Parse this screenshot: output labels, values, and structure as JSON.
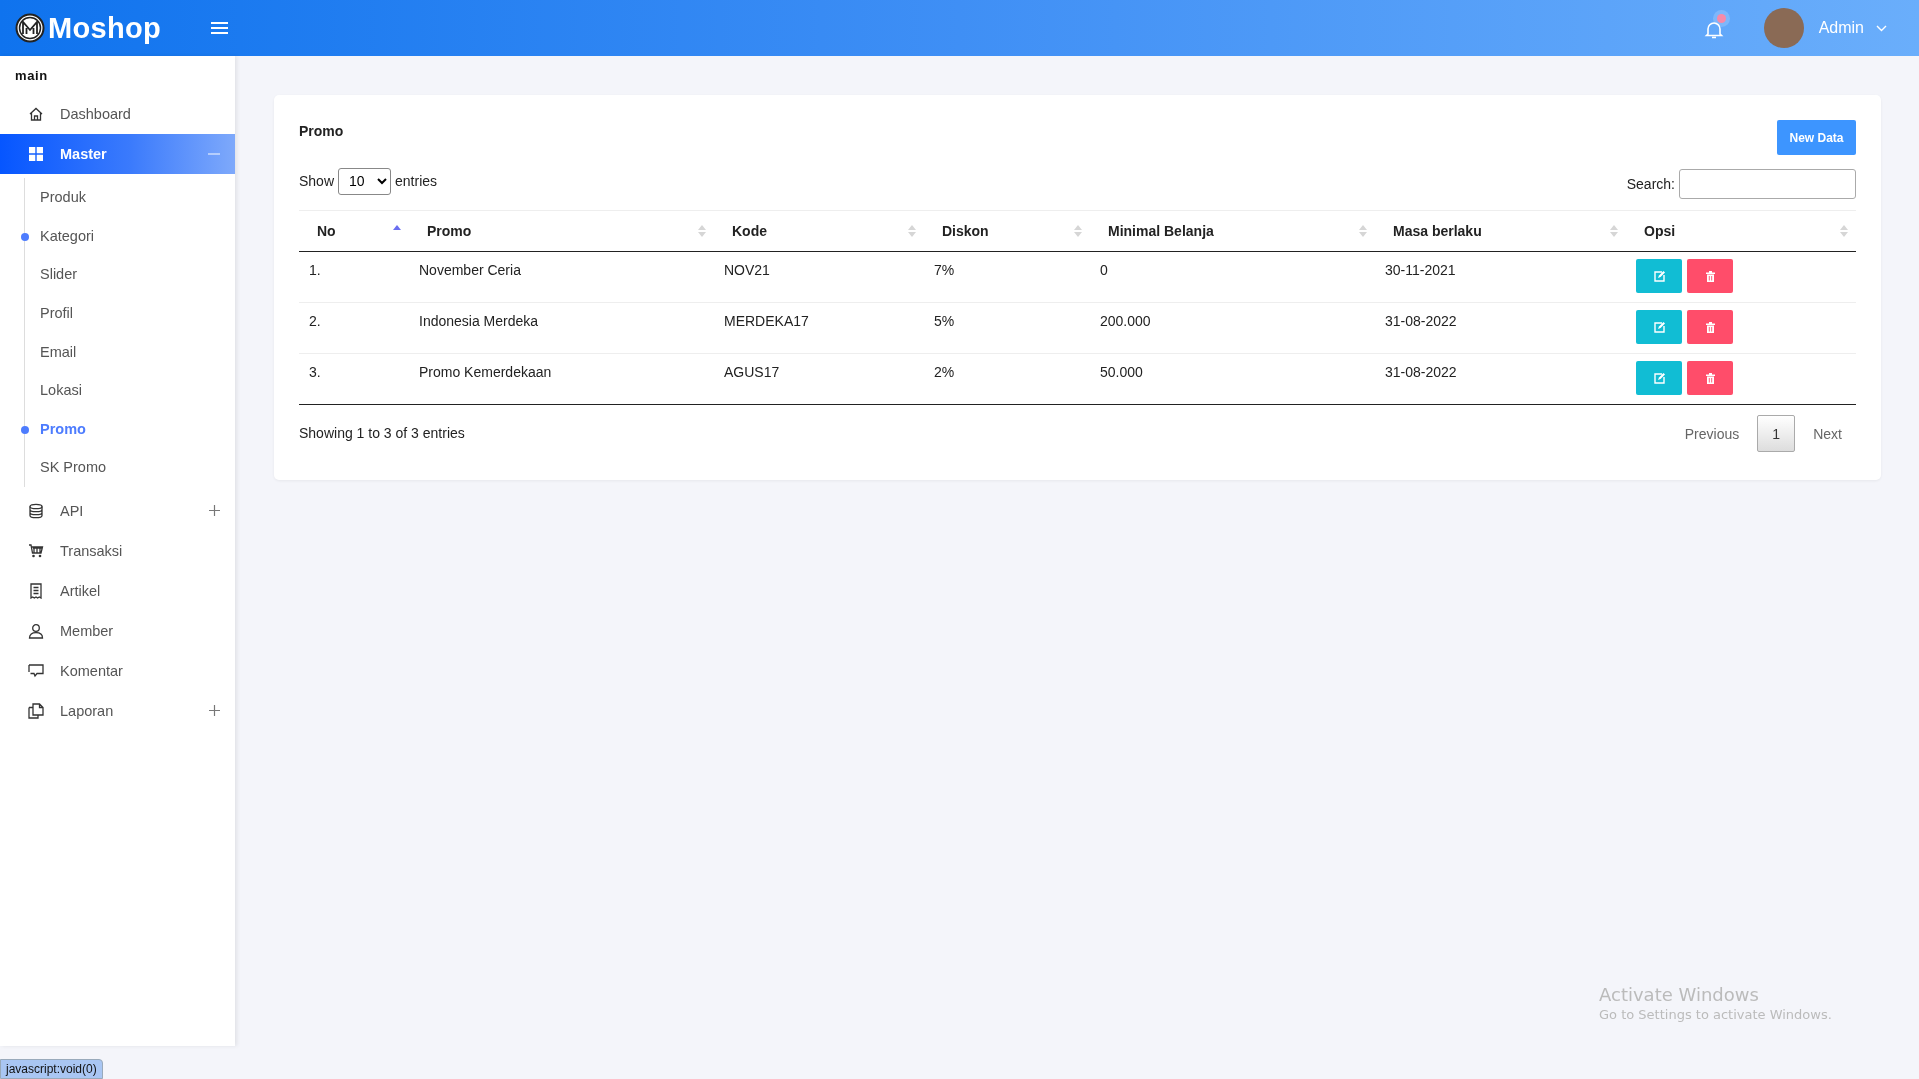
{
  "header": {
    "brand": "Moshop",
    "user": "Admin",
    "notification": true
  },
  "sidebar": {
    "section": "main",
    "items": [
      {
        "label": "Dashboard",
        "kind": "link",
        "selected": false
      },
      {
        "label": "Master",
        "kind": "group",
        "selected": true,
        "expanded": true,
        "children": [
          {
            "label": "Produk",
            "selected": false,
            "marked": false
          },
          {
            "label": "Kategori",
            "selected": false,
            "marked": true
          },
          {
            "label": "Slider",
            "selected": false,
            "marked": false
          },
          {
            "label": "Profil",
            "selected": false,
            "marked": false
          },
          {
            "label": "Email",
            "selected": false,
            "marked": false
          },
          {
            "label": "Lokasi",
            "selected": false,
            "marked": false
          },
          {
            "label": "Promo",
            "selected": true,
            "marked": true
          },
          {
            "label": "SK Promo",
            "selected": false,
            "marked": false
          }
        ]
      },
      {
        "label": "API",
        "kind": "group",
        "selected": false,
        "expanded": false
      },
      {
        "label": "Transaksi",
        "kind": "link",
        "selected": false
      },
      {
        "label": "Artikel",
        "kind": "link",
        "selected": false
      },
      {
        "label": "Member",
        "kind": "link",
        "selected": false
      },
      {
        "label": "Komentar",
        "kind": "link",
        "selected": false
      },
      {
        "label": "Laporan",
        "kind": "group",
        "selected": false,
        "expanded": false
      }
    ]
  },
  "card": {
    "title": "Promo",
    "new_button": "New Data",
    "show_label": "Show",
    "length_value": "10",
    "entries_label": "entries",
    "search_label": "Search:",
    "columns": [
      {
        "label": "No",
        "sorted": true
      },
      {
        "label": "Promo",
        "sorted": false
      },
      {
        "label": "Kode",
        "sorted": false
      },
      {
        "label": "Diskon",
        "sorted": false
      },
      {
        "label": "Minimal Belanja",
        "sorted": false
      },
      {
        "label": "Masa berlaku",
        "sorted": false
      },
      {
        "label": "Opsi",
        "sorted": false
      }
    ],
    "rows": [
      {
        "cells": [
          "1.",
          "November Ceria",
          "NOV21",
          "7%",
          "0",
          "30-11-2021"
        ]
      },
      {
        "cells": [
          "2.",
          "Indonesia Merdeka",
          "MERDEKA17",
          "5%",
          "200.000",
          "31-08-2022"
        ]
      },
      {
        "cells": [
          "3.",
          "Promo Kemerdekaan",
          "AGUS17",
          "2%",
          "50.000",
          "31-08-2022"
        ]
      }
    ],
    "info": "Showing 1 to 3 of 3 entries",
    "pagination": {
      "previous": "Previous",
      "pages": [
        {
          "label": "1",
          "selected": true
        }
      ],
      "next": "Next"
    }
  },
  "status_link": "javascript:void(0)",
  "os_notice": {
    "title": "Activate Windows",
    "message": "Go to Settings to activate Windows."
  }
}
